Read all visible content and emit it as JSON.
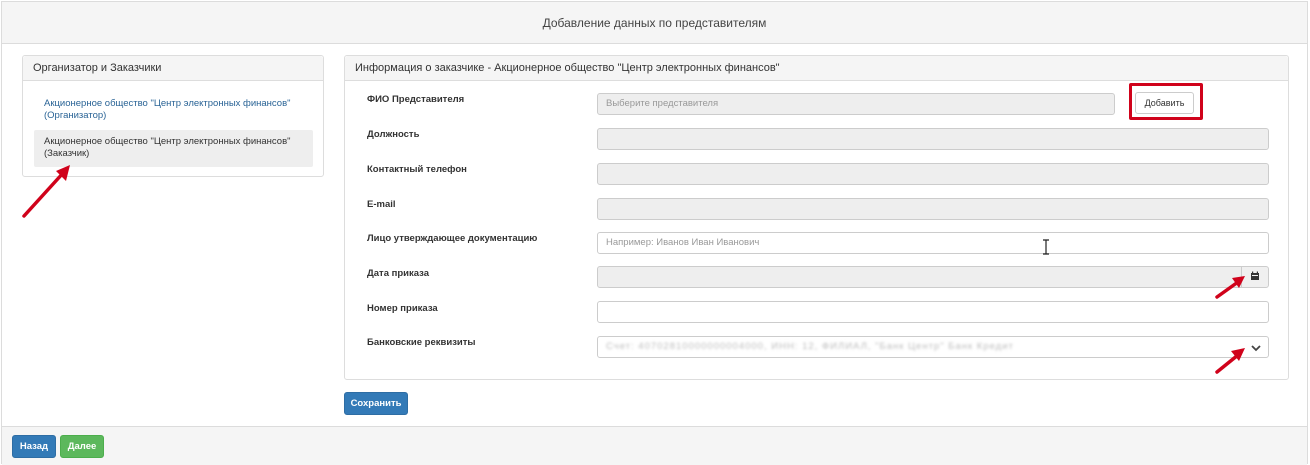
{
  "header": {
    "title": "Добавление данных по представителям"
  },
  "left_panel": {
    "title": "Организатор и Заказчики",
    "items": [
      {
        "label": "Акционерное общество \"Центр электронных финансов\" (Организатор)",
        "active": false
      },
      {
        "label": "Акционерное общество \"Центр электронных финансов\" (Заказчик)",
        "active": true
      }
    ]
  },
  "right_panel": {
    "title": "Информация о заказчике - Акционерное общество \"Центр электронных финансов\"",
    "fields": {
      "fio": {
        "label": "ФИО Представителя",
        "placeholder": "Выберите представителя",
        "add_label": "Добавить"
      },
      "position": {
        "label": "Должность",
        "value": ""
      },
      "phone": {
        "label": "Контактный телефон",
        "value": ""
      },
      "email": {
        "label": "E-mail",
        "value": ""
      },
      "approver": {
        "label": "Лицо утверждающее документацию",
        "placeholder": "Например: Иванов Иван Иванович"
      },
      "order_date": {
        "label": "Дата приказа",
        "value": ""
      },
      "order_number": {
        "label": "Номер приказа",
        "value": ""
      },
      "bank": {
        "label": "Банковские реквизиты",
        "value": "Счет: 40702810000000004000, ИНН: 12, ФИЛИАЛ, \"Банк Центр\" Банк Кредит"
      }
    },
    "save_label": "Сохранить"
  },
  "footer": {
    "back_label": "Назад",
    "next_label": "Далее"
  },
  "icons": {
    "calendar": "calendar-icon",
    "select": "chevron-down-icon",
    "annotation": "red-arrow-icon"
  },
  "colors": {
    "primary": "#337ab7",
    "success": "#5cb85c",
    "annotation": "#d0021b"
  }
}
